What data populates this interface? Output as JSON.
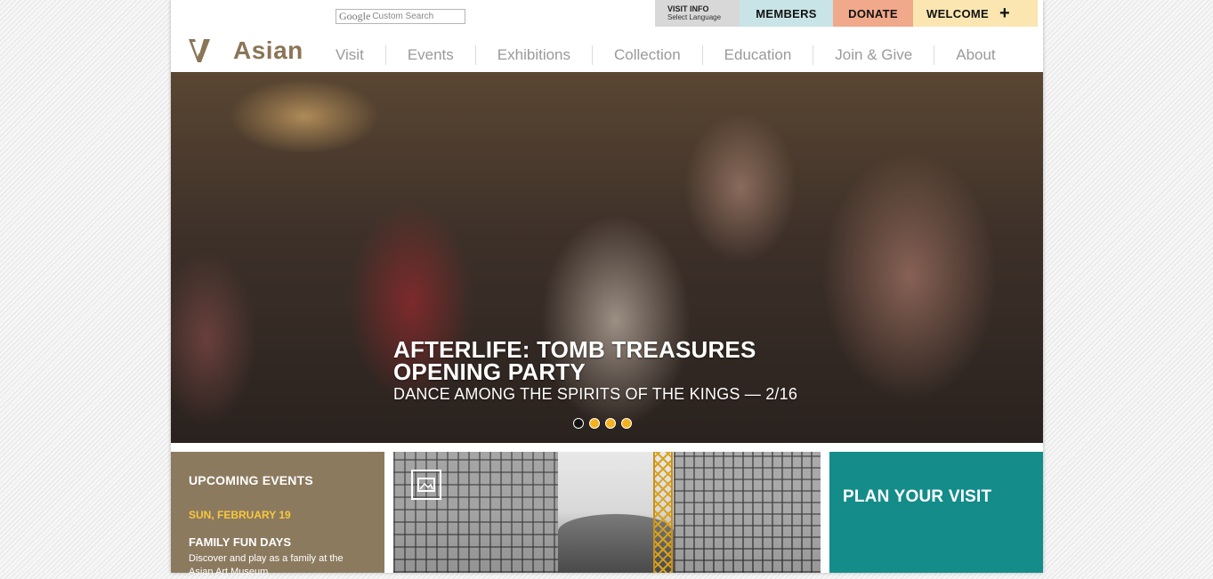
{
  "search": {
    "brand": "Google",
    "placeholder": "Custom Search"
  },
  "utility": {
    "visit_info": "VISIT INFO",
    "select_language": "Select Language",
    "members": "MEMBERS",
    "donate": "DONATE",
    "welcome": "WELCOME",
    "welcome_icon": "+"
  },
  "logo": {
    "text": "Asian",
    "mark_icon": "museum-logo-mark"
  },
  "nav": [
    "Visit",
    "Events",
    "Exhibitions",
    "Collection",
    "Education",
    "Join & Give",
    "About"
  ],
  "hero": {
    "title_line1": "AFTERLIFE: TOMB TREASURES",
    "title_line2": "OPENING PARTY",
    "subtitle": "DANCE AMONG THE SPIRITS OF THE KINGS — 2/16",
    "slides": 4,
    "active_slide": 1
  },
  "events_panel": {
    "heading": "UPCOMING EVENTS",
    "date": "SUN, FEBRUARY 19",
    "title": "FAMILY FUN DAYS",
    "description": "Discover and play as a family at the Asian Art Museum"
  },
  "image_panel": {
    "icon": "gallery-icon"
  },
  "plan_panel": {
    "heading": "PLAN YOUR VISIT"
  },
  "colors": {
    "brand_brown": "#8a7556",
    "members_bg": "#c8e4e6",
    "donate_bg": "#f0a98a",
    "welcome_bg": "#fbe6b2",
    "events_bg": "#8c7a5f",
    "event_date": "#f7c83e",
    "plan_bg": "#138c8a",
    "dot_active": "#111111",
    "dot_inactive": "#f2b21e"
  }
}
